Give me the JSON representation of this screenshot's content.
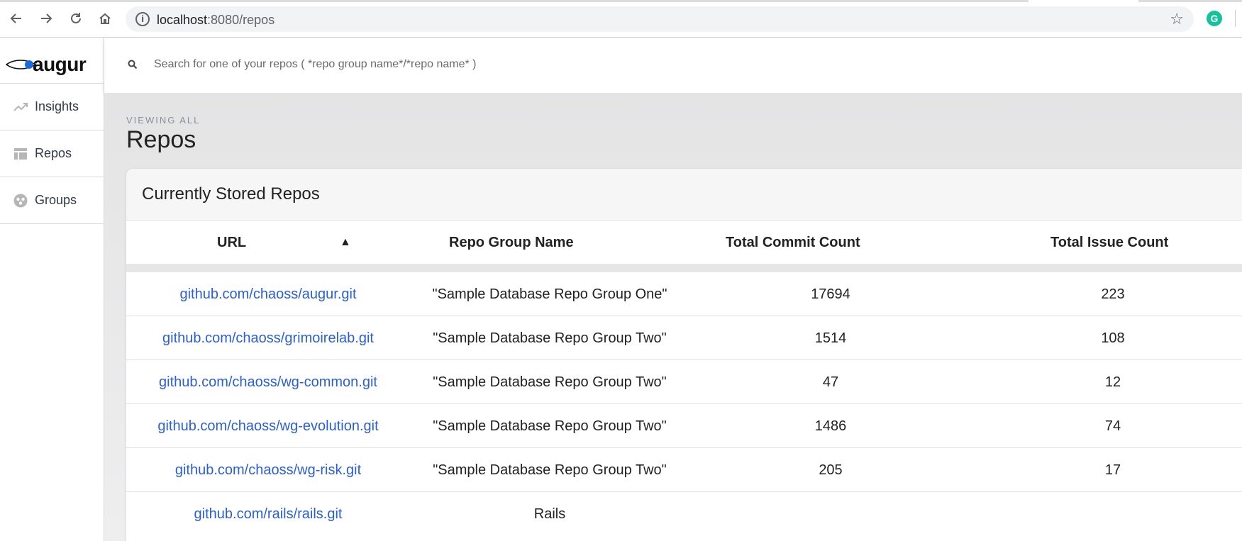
{
  "browser": {
    "url_host": "localhost",
    "url_port_path": ":8080/repos",
    "extension_badge": "G"
  },
  "app": {
    "logo_text": "augur",
    "search": {
      "placeholder": "Search for one of your repos ( *repo group name*/*repo name* )"
    },
    "sidebar": {
      "items": [
        {
          "label": "Insights",
          "icon": "trending-up-icon"
        },
        {
          "label": "Repos",
          "icon": "table-icon"
        },
        {
          "label": "Groups",
          "icon": "group-icon"
        }
      ]
    },
    "page": {
      "eyebrow": "VIEWING ALL",
      "title": "Repos"
    },
    "card": {
      "title": "Currently Stored Repos",
      "columns": [
        "URL",
        "Repo Group Name",
        "Total Commit Count",
        "Total Issue Count"
      ],
      "sort_indicator": "▲",
      "rows": [
        {
          "url": "github.com/chaoss/augur.git",
          "group": "\"Sample Database Repo Group One\"",
          "commits": "17694",
          "issues": "223"
        },
        {
          "url": "github.com/chaoss/grimoirelab.git",
          "group": "\"Sample Database Repo Group Two\"",
          "commits": "1514",
          "issues": "108"
        },
        {
          "url": "github.com/chaoss/wg-common.git",
          "group": "\"Sample Database Repo Group Two\"",
          "commits": "47",
          "issues": "12"
        },
        {
          "url": "github.com/chaoss/wg-evolution.git",
          "group": "\"Sample Database Repo Group Two\"",
          "commits": "1486",
          "issues": "74"
        },
        {
          "url": "github.com/chaoss/wg-risk.git",
          "group": "\"Sample Database Repo Group Two\"",
          "commits": "205",
          "issues": "17"
        },
        {
          "url": "github.com/rails/rails.git",
          "group": "Rails",
          "commits": "",
          "issues": ""
        }
      ]
    }
  },
  "colors": {
    "link": "#2b5fd9",
    "accent_green": "#15c39a"
  }
}
